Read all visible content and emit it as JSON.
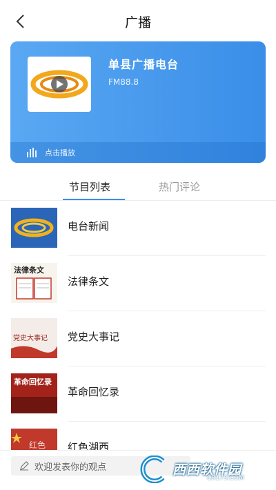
{
  "header": {
    "title": "广播"
  },
  "station": {
    "name": "单县广播电台",
    "frequency": "FM88.8",
    "play_label": "点击播放"
  },
  "tabs": [
    {
      "label": "节目列表",
      "active": true
    },
    {
      "label": "热门评论",
      "active": false
    }
  ],
  "programs": [
    {
      "title": "电台新闻"
    },
    {
      "title": "法律条文",
      "thumb_text": "法律条文"
    },
    {
      "title": "党史大事记",
      "thumb_text": "党史大事记"
    },
    {
      "title": "革命回忆录",
      "thumb_text": "革命回忆录"
    },
    {
      "title": "红色湖西",
      "thumb_text": "红色"
    }
  ],
  "comment": {
    "placeholder": "欢迎发表你的观点"
  },
  "watermark": {
    "text": "西西软件园",
    "sub": "CR173.COM"
  },
  "colors": {
    "accent": "#3a8ee8",
    "card_start": "#5aa8f3"
  }
}
